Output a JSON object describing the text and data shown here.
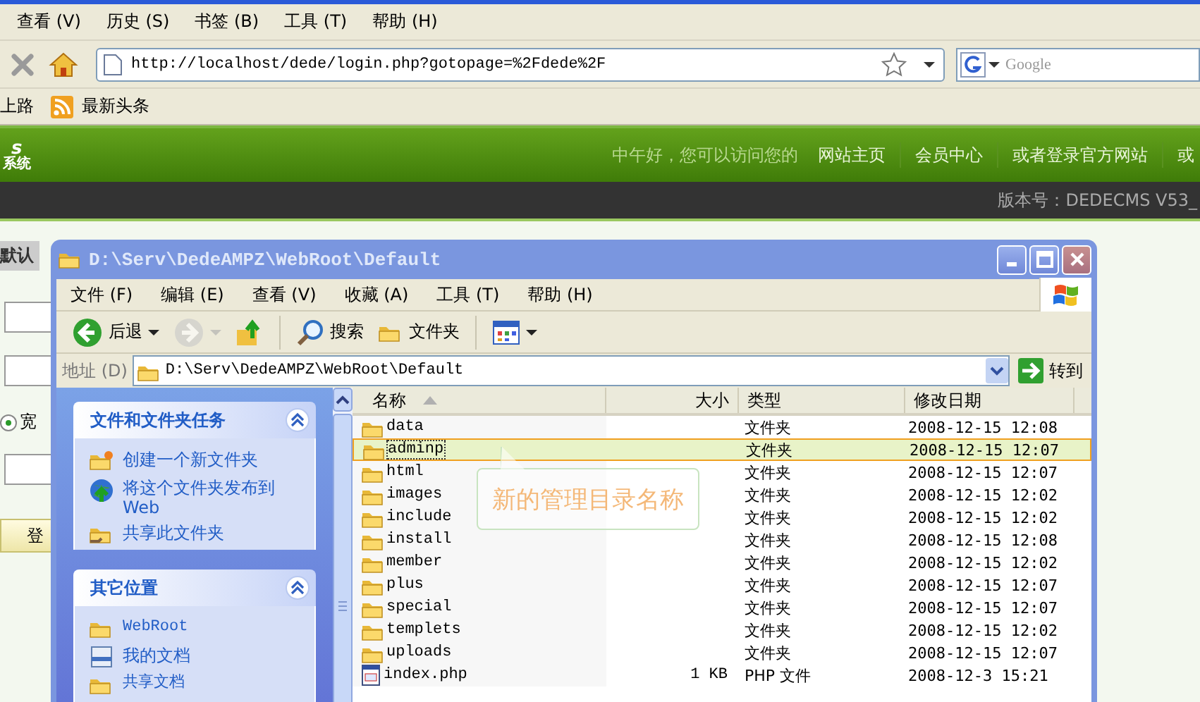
{
  "browser": {
    "menu": [
      "查看 (V)",
      "历史 (S)",
      "书签 (B)",
      "工具 (T)",
      "帮助 (H)"
    ],
    "url": "http://localhost/dede/login.php?gotopage=%2Fdede%2F",
    "search": {
      "placeholder": "Google"
    },
    "bookmarks": [
      {
        "kind": "plain",
        "label": "上路"
      },
      {
        "kind": "feed",
        "label": "最新头条"
      }
    ]
  },
  "site": {
    "logo": [
      "s",
      "系统"
    ],
    "nav": [
      "中午好，您可以访问您的",
      "网站主页",
      "会员中心",
      "或者登录官方网站",
      "或"
    ],
    "version": "版本号：DEDECMS V53_"
  },
  "login": {
    "label": "默认",
    "radio": {
      "label": "宽",
      "checked": true
    },
    "button": "登"
  },
  "explorer": {
    "title": "D:\\Serv\\DedeAMPZ\\WebRoot\\Default",
    "menu": [
      "文件 (F)",
      "编辑 (E)",
      "查看 (V)",
      "收藏 (A)",
      "工具 (T)",
      "帮助 (H)"
    ],
    "toolbar": [
      {
        "kind": "back",
        "label": "后退",
        "disabled": false
      },
      {
        "kind": "forward",
        "disabled": true
      },
      {
        "kind": "up",
        "disabled": false
      },
      {
        "kind": "search",
        "label": "搜索",
        "disabled": false
      },
      {
        "kind": "folders",
        "label": "文件夹",
        "disabled": false
      },
      {
        "kind": "views",
        "disabled": false
      }
    ],
    "address": {
      "label": "地址 (D)",
      "value": "D:\\Serv\\DedeAMPZ\\WebRoot\\Default",
      "go": "转到"
    },
    "panels": [
      {
        "title": "文件和文件夹任务",
        "expanded": true,
        "items": [
          {
            "kind": "new-folder",
            "label": "创建一个新文件夹"
          },
          {
            "kind": "publish",
            "label": "将这个文件夹发布到 Web"
          },
          {
            "kind": "share",
            "label": "共享此文件夹"
          }
        ]
      },
      {
        "title": "其它位置",
        "expanded": true,
        "items": [
          {
            "kind": "folder",
            "label": "WebRoot"
          },
          {
            "kind": "documents",
            "label": "我的文档"
          },
          {
            "kind": "folder",
            "label": "共享文档"
          }
        ]
      }
    ],
    "columns": [
      {
        "label": "名称",
        "sorted": true
      },
      {
        "label": "大小",
        "sorted": false
      },
      {
        "label": "类型",
        "sorted": false
      },
      {
        "label": "修改日期",
        "sorted": false
      }
    ],
    "rows": [
      {
        "kind": "folder",
        "name": "data",
        "type": "文件夹",
        "date": "2008-12-15 12:08",
        "selected": false
      },
      {
        "kind": "folder",
        "name": "adminp",
        "type": "文件夹",
        "date": "2008-12-15 12:07",
        "selected": true
      },
      {
        "kind": "folder",
        "name": "html",
        "type": "文件夹",
        "date": "2008-12-15 12:07",
        "selected": false
      },
      {
        "kind": "folder",
        "name": "images",
        "type": "文件夹",
        "date": "2008-12-15 12:02",
        "selected": false
      },
      {
        "kind": "folder",
        "name": "include",
        "type": "文件夹",
        "date": "2008-12-15 12:02",
        "selected": false
      },
      {
        "kind": "folder",
        "name": "install",
        "type": "文件夹",
        "date": "2008-12-15 12:08",
        "selected": false
      },
      {
        "kind": "folder",
        "name": "member",
        "type": "文件夹",
        "date": "2008-12-15 12:02",
        "selected": false
      },
      {
        "kind": "folder",
        "name": "plus",
        "type": "文件夹",
        "date": "2008-12-15 12:07",
        "selected": false
      },
      {
        "kind": "folder",
        "name": "special",
        "type": "文件夹",
        "date": "2008-12-15 12:07",
        "selected": false
      },
      {
        "kind": "folder",
        "name": "templets",
        "type": "文件夹",
        "date": "2008-12-15 12:02",
        "selected": false
      },
      {
        "kind": "folder",
        "name": "uploads",
        "type": "文件夹",
        "date": "2008-12-15 12:07",
        "selected": false
      },
      {
        "kind": "php",
        "name": "index.php",
        "size": "1 KB",
        "type": "PHP 文件",
        "date": "2008-12-3 15:21",
        "selected": false
      }
    ],
    "tooltip": "新的管理目录名称"
  }
}
